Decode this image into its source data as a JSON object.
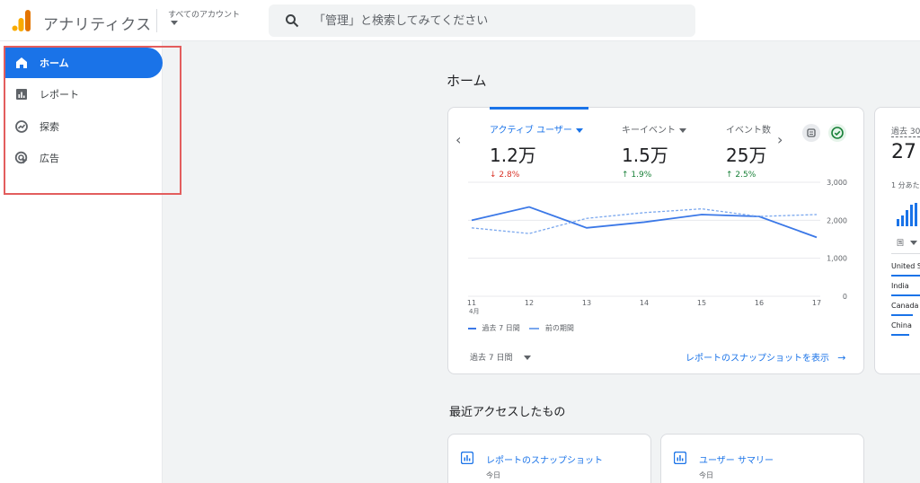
{
  "header": {
    "app_title": "アナリティクス",
    "account_label": "すべてのアカウント",
    "search_placeholder": "「管理」と検索してみてください",
    "logo_icon": "analytics-logo-icon",
    "search_icon": "search-icon",
    "colors": {
      "logo_dark": "#e37400",
      "logo_light": "#f9ab00"
    }
  },
  "sidebar": {
    "items": [
      {
        "label": "ホーム",
        "icon": "home-icon",
        "active": true
      },
      {
        "label": "レポート",
        "icon": "bar-chart-icon",
        "active": false
      },
      {
        "label": "探索",
        "icon": "explore-icon",
        "active": false
      },
      {
        "label": "広告",
        "icon": "ads-icon",
        "active": false
      }
    ],
    "accent": "#1a73e8",
    "highlight_border": "#e35d5d"
  },
  "main": {
    "page_title": "ホーム",
    "metrics": [
      {
        "label": "アクティブ ユーザー",
        "value": "1.2万",
        "change": "2.8%",
        "direction": "down"
      },
      {
        "label": "キーイベント",
        "value": "1.5万",
        "change": "1.9%",
        "direction": "up"
      },
      {
        "label": "イベント数",
        "value": "25万",
        "change": "2.5%",
        "direction": "up"
      }
    ],
    "legend_current": "過去 7 日間",
    "legend_previous": "前の期間",
    "period_select": "過去 7 日間",
    "snapshot_link": "レポートのスナップショットを表示",
    "side_card": {
      "label": "過去 30",
      "value": "27",
      "sub": "1 分あた",
      "country_header": "国",
      "countries": [
        "United S",
        "India",
        "Canada",
        "China"
      ]
    },
    "recent_title": "最近アクセスしたもの",
    "recent_cards": [
      {
        "title": "レポートのスナップショット",
        "sub": "今日"
      },
      {
        "title": "ユーザー サマリー",
        "sub": "今日"
      }
    ]
  },
  "chart_data": {
    "type": "line",
    "x": [
      "11",
      "12",
      "13",
      "14",
      "15",
      "16",
      "17"
    ],
    "x_sublabel": "4月",
    "ylim": [
      0,
      3000
    ],
    "y_ticks": [
      "3,000",
      "2,000",
      "1,000",
      "0"
    ],
    "series": [
      {
        "name": "過去 7 日間",
        "values": [
          2000,
          2350,
          1800,
          1950,
          2150,
          2100,
          1550
        ],
        "style": "solid",
        "color": "#3b78e7"
      },
      {
        "name": "前の期間",
        "values": [
          1800,
          1650,
          2050,
          2200,
          2300,
          2100,
          2150
        ],
        "style": "dashed",
        "color": "#7aa7ee"
      }
    ],
    "grid": true
  }
}
